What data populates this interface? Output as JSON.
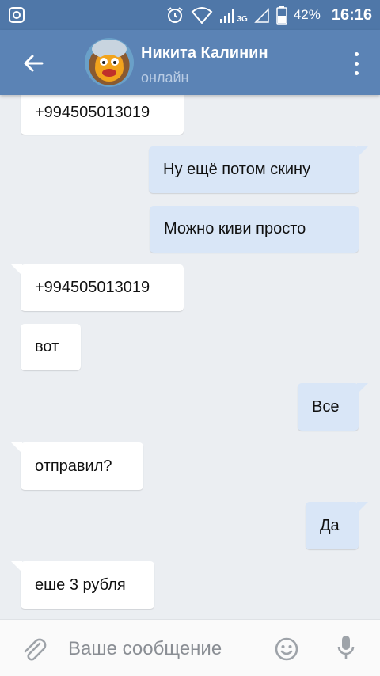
{
  "statusbar": {
    "network": "3G",
    "battery": "42%",
    "time": "16:16",
    "icons": [
      "app-notification-icon",
      "alarm-icon",
      "wifi-icon",
      "signal-icon",
      "signal-empty-icon",
      "battery-icon"
    ]
  },
  "header": {
    "contact_name": "Никита Калинин",
    "contact_status": "онлайн",
    "colors": {
      "statusbar": "#4f77a8",
      "appbar": "#5b83b5",
      "status_text": "#b9cce4"
    }
  },
  "messages": [
    {
      "side": "in",
      "text": "+994505013019",
      "tail": false
    },
    {
      "side": "out",
      "text": "Ну ещё потом скину",
      "tail": true
    },
    {
      "side": "out",
      "text": "Можно киви просто",
      "tail": false
    },
    {
      "side": "in",
      "text": "+994505013019",
      "tail": true
    },
    {
      "side": "in",
      "text": "вот",
      "tail": false
    },
    {
      "side": "out",
      "text": "Все",
      "tail": true
    },
    {
      "side": "in",
      "text": "отправил?",
      "tail": true
    },
    {
      "side": "out",
      "text": "Да",
      "tail": true
    },
    {
      "side": "in",
      "text": "еше 3 рубля",
      "tail": true
    }
  ],
  "composer": {
    "placeholder": "Ваше сообщение",
    "icons": [
      "attach-icon",
      "emoji-icon",
      "microphone-icon"
    ]
  },
  "colors": {
    "background": "#ebeef2",
    "incoming_bubble": "#ffffff",
    "outgoing_bubble": "#d9e6f7"
  }
}
